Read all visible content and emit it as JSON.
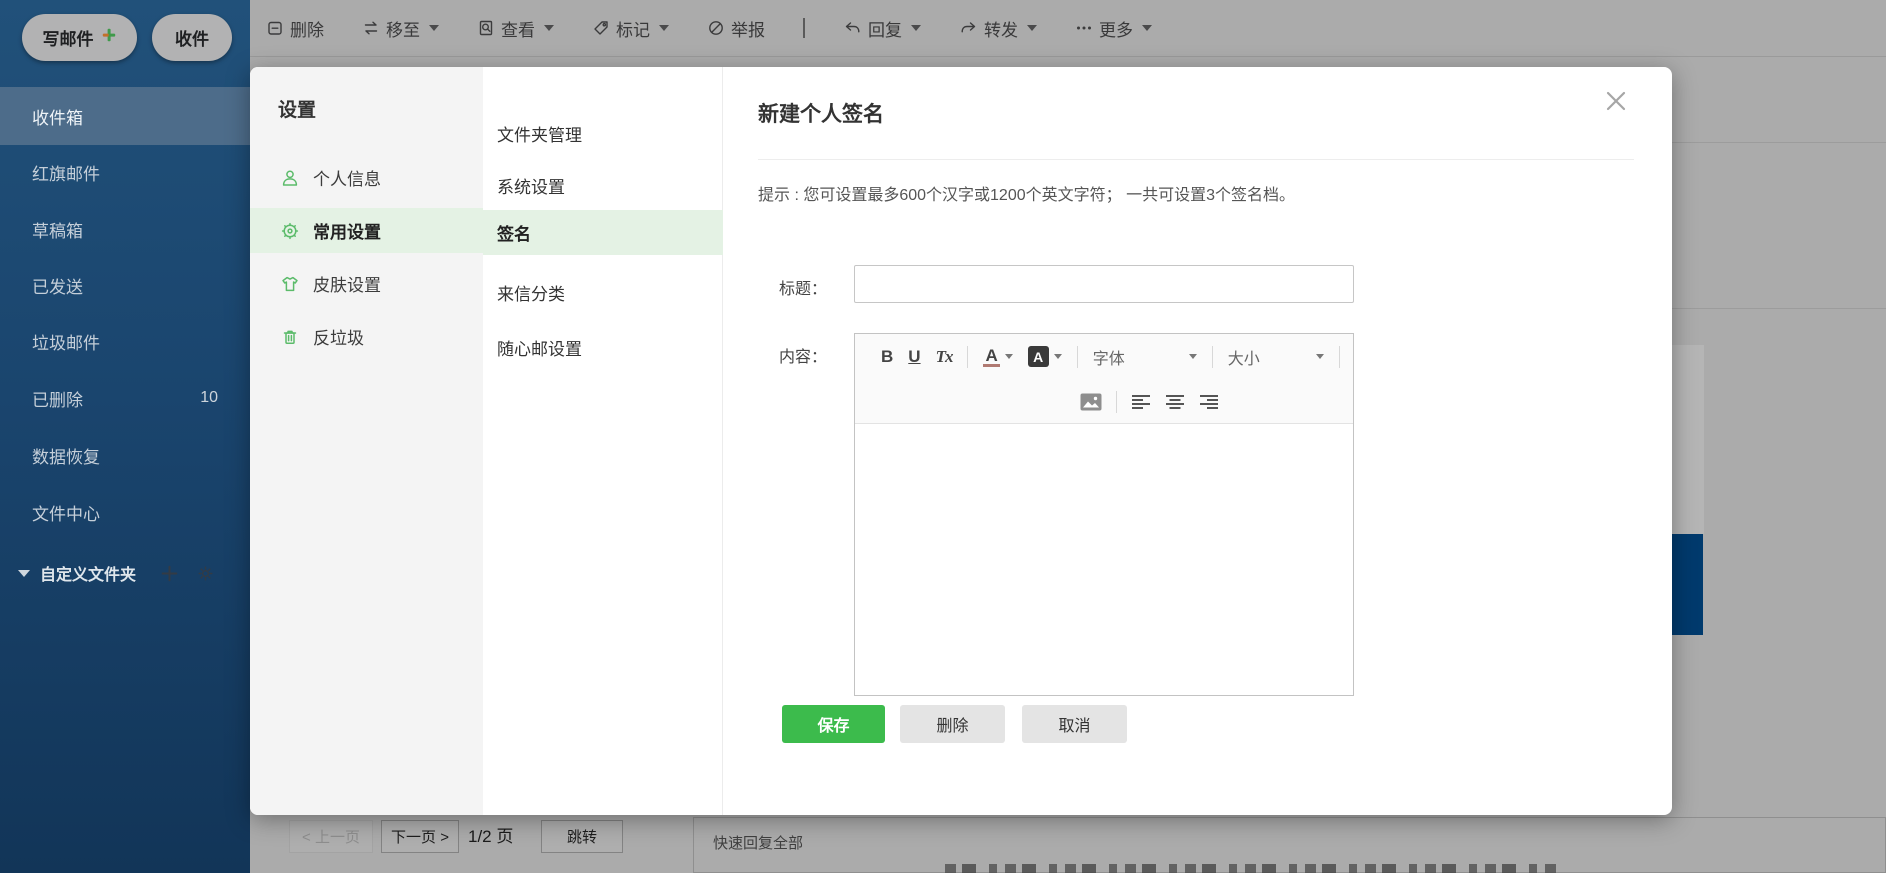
{
  "actions": {
    "compose": "写邮件",
    "receive": "收件"
  },
  "sidebar": {
    "folders": [
      {
        "label": "收件箱",
        "selected": true
      },
      {
        "label": "红旗邮件"
      },
      {
        "label": "草稿箱"
      },
      {
        "label": "已发送"
      },
      {
        "label": "垃圾邮件"
      },
      {
        "label": "已删除",
        "count": "10"
      },
      {
        "label": "数据恢复"
      },
      {
        "label": "文件中心"
      }
    ],
    "custom_folders_label": "自定义文件夹"
  },
  "toolbar": {
    "items": [
      {
        "label": "删除"
      },
      {
        "label": "移至"
      },
      {
        "label": "查看"
      },
      {
        "label": "标记"
      },
      {
        "label": "举报"
      },
      {
        "label": "回复"
      },
      {
        "label": "转发"
      },
      {
        "label": "更多"
      }
    ]
  },
  "settings": {
    "title": "设置",
    "menu": [
      {
        "label": "个人信息"
      },
      {
        "label": "常用设置",
        "active": true
      },
      {
        "label": "皮肤设置"
      },
      {
        "label": "反垃圾"
      }
    ],
    "submenu": [
      {
        "label": "文件夹管理"
      },
      {
        "label": "系统设置"
      },
      {
        "label": "签名",
        "active": true
      },
      {
        "label": "来信分类"
      },
      {
        "label": "随心邮设置"
      }
    ]
  },
  "signature_panel": {
    "title": "新建个人签名",
    "hint": "提示 : 您可设置最多600个汉字或1200个英文字符； 一共可设置3个签名档。",
    "form": {
      "title_label": "标题：",
      "content_label": "内容：",
      "title_value": ""
    },
    "editor": {
      "bold": "B",
      "underline": "U",
      "clear_format": "Tx",
      "font_color": "A",
      "bg_color": "A",
      "font_family": "字体",
      "font_size": "大小"
    },
    "buttons": {
      "save": "保存",
      "delete": "删除",
      "cancel": "取消"
    }
  },
  "pagination": {
    "prev": "< 上一页",
    "next": "下一页 >",
    "page_indicator": "1/2 页",
    "jump": "跳转"
  },
  "quick_reply": {
    "label": "快速回复全部"
  },
  "colors": {
    "accent_green": "#3cbb4c",
    "menu_highlight": "#e4f2e4",
    "icon_green": "#5bbb6a",
    "sidebar_selected": "#4d6c8a",
    "dim_background": "#ababab",
    "side_tab_blue": "#003a6d"
  }
}
